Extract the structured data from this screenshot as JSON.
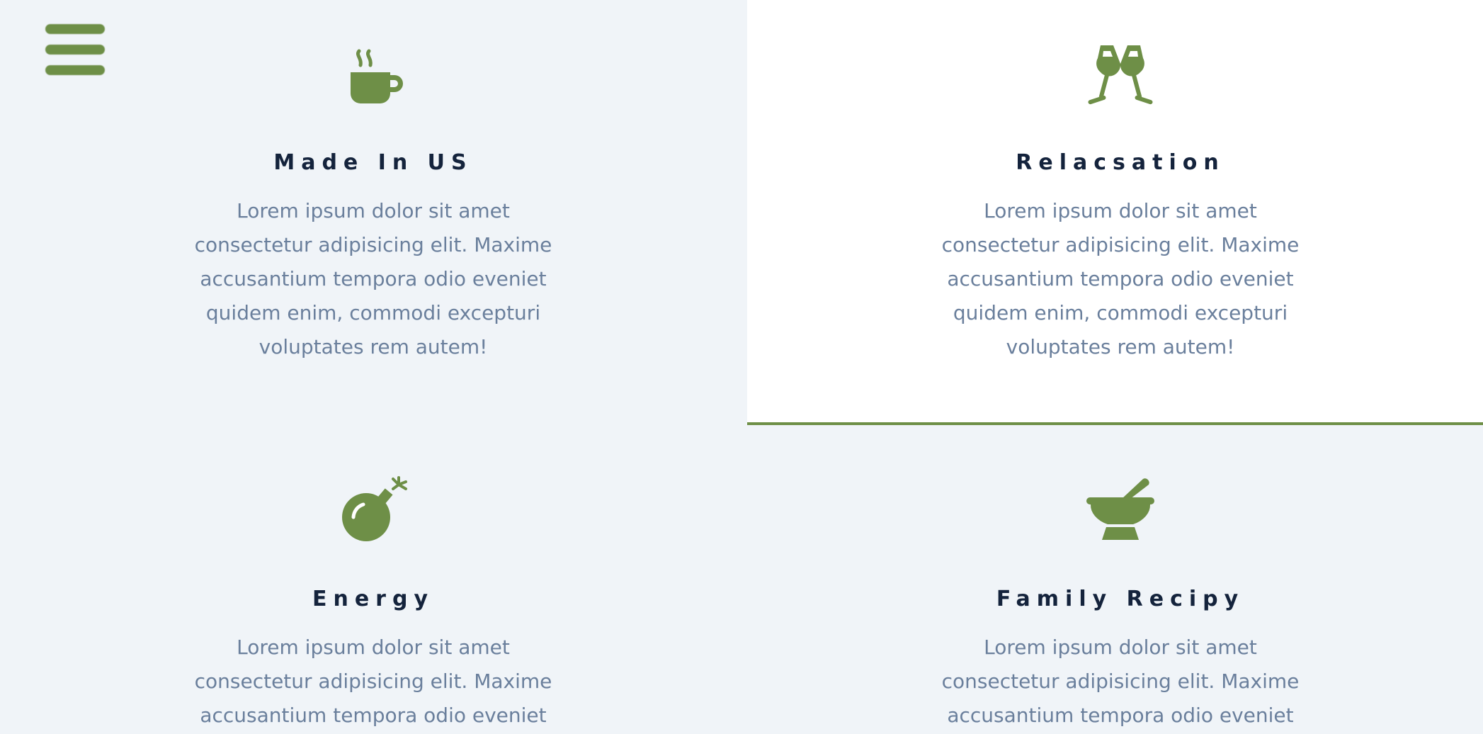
{
  "colors": {
    "accent": "#6e8f47",
    "heading": "#14233c",
    "body_text": "#6a7f9c",
    "panel_light": "#f0f4f8",
    "panel_white": "#ffffff"
  },
  "menu": {
    "icon": "hamburger-menu-icon"
  },
  "features": [
    {
      "icon": "coffee-mug-icon",
      "title": "Made In US",
      "text": "Lorem ipsum dolor sit amet consectetur adipisicing elit. Maxime accusantium tempora odio eveniet quidem enim, commodi excepturi voluptates rem autem!"
    },
    {
      "icon": "glass-cheers-icon",
      "title": "Relacsation",
      "text": "Lorem ipsum dolor sit amet consectetur adipisicing elit. Maxime accusantium tempora odio eveniet quidem enim, commodi excepturi voluptates rem autem!"
    },
    {
      "icon": "bomb-icon",
      "title": "Energy",
      "text": "Lorem ipsum dolor sit amet consectetur adipisicing elit. Maxime accusantium tempora odio eveniet quidem enim,"
    },
    {
      "icon": "mortar-pestle-icon",
      "title": "Family Recipy",
      "text": "Lorem ipsum dolor sit amet consectetur adipisicing elit. Maxime accusantium tempora odio eveniet quidem enim,"
    }
  ]
}
